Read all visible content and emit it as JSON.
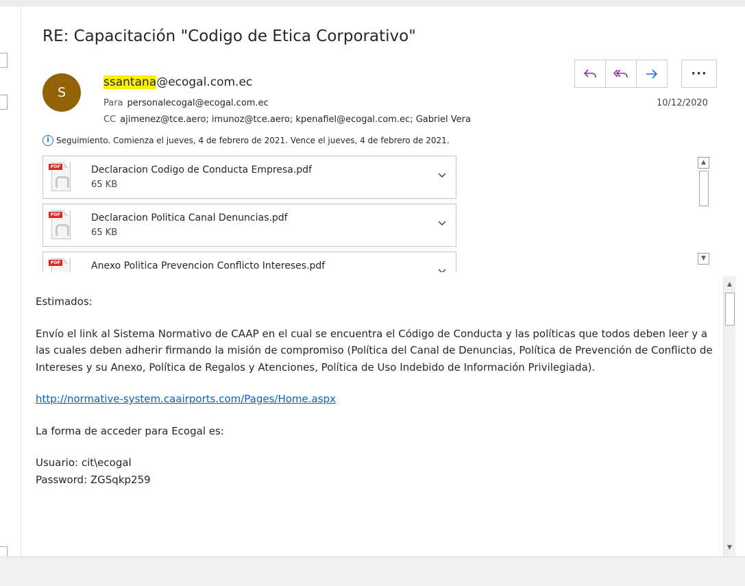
{
  "subject": "RE: Capacitación \"Codigo de Etica Corporativo\"",
  "sender": {
    "avatar_initial": "S",
    "avatar_color": "#926207",
    "highlighted_name": "ssantana",
    "domain": "@ecogal.com.ec",
    "to_label": "Para",
    "to_value": "personalecogal@ecogal.com.ec",
    "cc_label": "CC",
    "cc_value": "ajimenez@tce.aero; imunoz@tce.aero; kpenafiel@ecogal.com.ec; Gabriel Vera",
    "date": "10/12/2020"
  },
  "actions": {
    "reply_icon": "reply-icon",
    "reply_all_icon": "reply-all-icon",
    "forward_icon": "forward-icon",
    "more_label": "···"
  },
  "followup": "Seguimiento.  Comienza el jueves, 4 de febrero de 2021.  Vence el jueves, 4 de febrero de 2021.",
  "attachments": [
    {
      "name": "Declaracion Codigo de Conducta Empresa.pdf",
      "size": "65 KB",
      "type_tag": "PDF"
    },
    {
      "name": "Declaracion Politica Canal Denuncias.pdf",
      "size": "65 KB",
      "type_tag": "PDF"
    },
    {
      "name": "Anexo Politica Prevencion Conflicto Intereses.pdf",
      "size": "",
      "type_tag": "PDF"
    }
  ],
  "body": {
    "greeting": "Estimados:",
    "paragraph": "Envío el link al Sistema Normativo de CAAP en el cual se encuentra el Código de Conducta y las políticas que todos deben leer y a las cuales deben adherir firmando la misión de compromiso (Política del Canal de Denuncias, Política de Prevención de Conflicto de Intereses y su Anexo, Política de Regalos y Atenciones, Política de Uso Indebido de Información Privilegiada).",
    "link": "http://normative-system.caairports.com/Pages/Home.aspx",
    "access_intro": "La forma de acceder para Ecogal es:",
    "user_line": "Usuario: cit\\ecogal",
    "password_line": "Password: ZGSqkp259"
  },
  "colors": {
    "highlight": "#fff200",
    "link": "#0563c1",
    "reply_purple": "#8a2da6",
    "forward_blue": "#1f6fd1",
    "pdf_red": "#e2261c"
  }
}
